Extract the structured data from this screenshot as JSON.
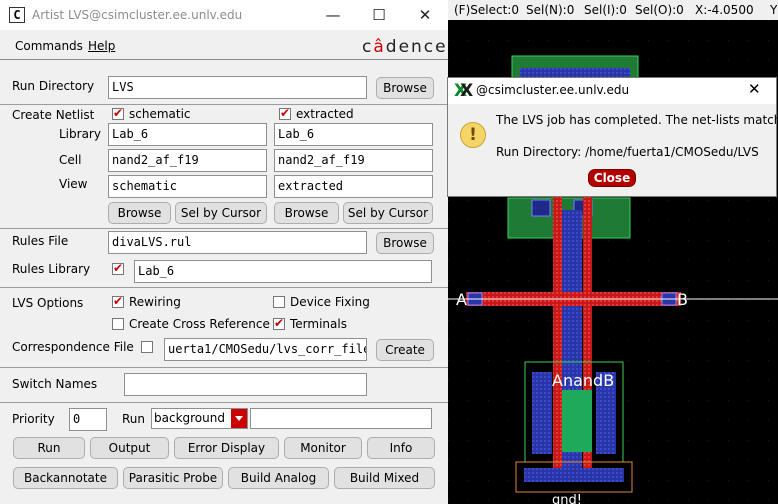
{
  "lvs_window": {
    "title": "Artist LVS@csimcluster.ee.unlv.edu",
    "icon_text": "C",
    "controls": {
      "minimize": "—",
      "maximize": "☐",
      "close": "✕"
    },
    "menu": {
      "commands": "Commands",
      "help": "Help"
    },
    "brand": {
      "pre": "c",
      "dot": "â",
      "post": "dence"
    },
    "run_directory": {
      "label": "Run Directory",
      "value": "LVS",
      "browse": "Browse"
    },
    "create_netlist": {
      "label": "Create Netlist",
      "schematic": {
        "checked": true,
        "label": "schematic",
        "library": "Lab_6",
        "cell": "nand2_af_f19",
        "view": "schematic"
      },
      "extracted": {
        "checked": true,
        "label": "extracted",
        "library": "Lab_6",
        "cell": "nand2_af_f19",
        "view": "extracted"
      },
      "library_label": "Library",
      "cell_label": "Cell",
      "view_label": "View",
      "browse": "Browse",
      "sel_by_cursor": "Sel by Cursor"
    },
    "rules_file": {
      "label": "Rules File",
      "value": "divaLVS.rul",
      "browse": "Browse"
    },
    "rules_library": {
      "label": "Rules Library",
      "checked": true,
      "value": "Lab_6"
    },
    "lvs_options": {
      "label": "LVS Options",
      "rewiring": {
        "label": "Rewiring",
        "checked": true
      },
      "device_fixing": {
        "label": "Device Fixing",
        "checked": false
      },
      "create_cross_reference": {
        "label": "Create Cross Reference",
        "checked": false
      },
      "terminals": {
        "label": "Terminals",
        "checked": true
      }
    },
    "correspondence_file": {
      "label": "Correspondence File",
      "checked": false,
      "value": "uerta1/CMOSedu/lvs_corr_file",
      "create": "Create"
    },
    "switch_names": {
      "label": "Switch Names",
      "value": ""
    },
    "priority": {
      "label": "Priority",
      "value": "0"
    },
    "run_mode": {
      "label": "Run",
      "value": "background",
      "extra": ""
    },
    "buttons_row1": [
      "Run",
      "Output",
      "Error Display",
      "Monitor",
      "Info"
    ],
    "buttons_row2": [
      "Backannotate",
      "Parasitic Probe",
      "Build Analog",
      "Build Mixed"
    ]
  },
  "status_bar": {
    "select": "(F)Select:0",
    "sel_n": "Sel(N):0",
    "sel_i": "Sel(I):0",
    "sel_o": "Sel(O):0",
    "x": "X:-4.0500",
    "y": "Y"
  },
  "layout": {
    "label_a": "A",
    "label_b": "B",
    "label_anandb": "AnandB",
    "label_bottom": "gnd!",
    "colors": {
      "poly": "#d42020",
      "metal1": "#2a3ab0",
      "nwell": "#3aa83a",
      "diff": "#1eaa5a",
      "contact": "#1e2a8a",
      "label": "#ffffff"
    }
  },
  "dialog": {
    "title": "@csimcluster.ee.unlv.edu",
    "close_x": "✕",
    "message": "The LVS job has completed. The net-lists match.",
    "run_directory": "Run Directory: /home/fuerta1/CMOSedu/LVS",
    "close_button": "Close",
    "icon_glyph": "!"
  }
}
